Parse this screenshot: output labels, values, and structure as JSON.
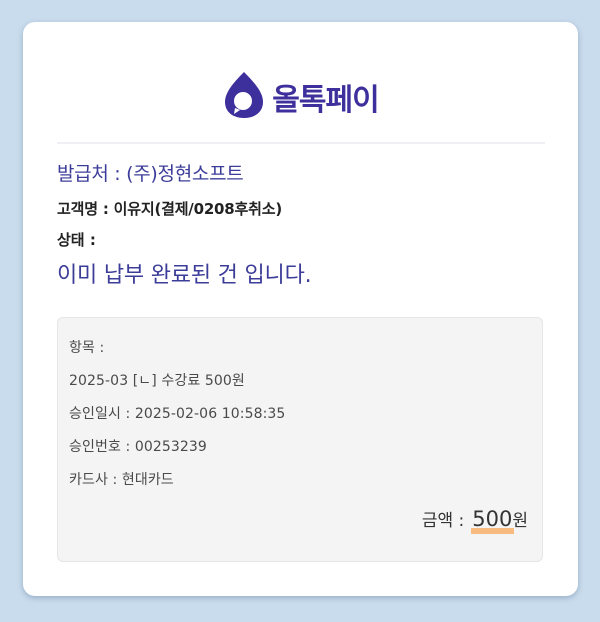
{
  "brand": {
    "name": "올톡페이",
    "logo_icon": "drop-logo-icon",
    "color": "#3d2f9c"
  },
  "receipt": {
    "issuer": "발급처 : (주)정현소프트",
    "customer": "고객명 : 이유지(결제/0208후취소)",
    "status_label": "상태 :",
    "status_message": "이미 납부 완료된 건 입니다."
  },
  "details": {
    "item_label": "항목 :",
    "item_value": "2025-03 [ㄴ] 수강료 500원",
    "approval_datetime": "승인일시 : 2025-02-06 10:58:35",
    "approval_number": "승인번호 : 00253239",
    "card_company": "카드사 : 현대카드",
    "amount_label": "금액 :",
    "amount_value": "500",
    "amount_unit": "원"
  },
  "colors": {
    "background": "#c9dced",
    "accent": "#3c3d99",
    "highlight": "#f7b06a"
  }
}
